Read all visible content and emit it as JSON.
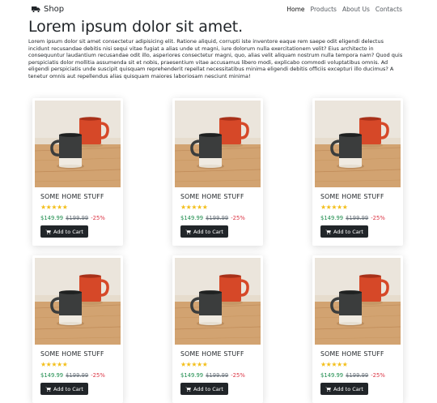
{
  "nav": {
    "brand": "Shop",
    "links": [
      "Home",
      "Products",
      "About Us",
      "Contacts"
    ],
    "active": "Home"
  },
  "hero": {
    "title": "Lorem ipsum dolor sit amet.",
    "text": "Lorem ipsum dolor sit amet consectetur adipisicing elit. Ratione aliquid, corrupti iste inventore eaque rem saepe odit eligendi delectus incidunt recusandae debitis nisi sequi vitae fugiat a alias unde ut magni, iure dolorum nulla exercitationem velit? Eius architecto in consequuntur laudantium recusandae odit illo, asperiores consectetur magni, quo, alias velit aliquam nostrum nulla tempora nam? Quod quis perspiciatis dolor mollitia assumenda sit et nobis, praesentium vitae accusamus libero modi, explicabo commodi voluptatibus omnis. Ad eligendi perspiciatis unde suscipit quisquam reprehenderit repellat necessitatibus minima eligendi debitis officiis excepturi illo ducimus? A tenetur omnis aut repellendus alias quisquam maiores laboriosam nesciunt minima!"
  },
  "products": [
    {
      "name": "SOME HOME STUFF",
      "rating": 4.5,
      "price": "$149.99",
      "old_price": "$199.99",
      "discount": "-25%",
      "button": "Add to Cart"
    },
    {
      "name": "SOME HOME STUFF",
      "rating": 4.5,
      "price": "$149.99",
      "old_price": "$199.99",
      "discount": "-25%",
      "button": "Add to Cart"
    },
    {
      "name": "SOME HOME STUFF",
      "rating": 4.5,
      "price": "$149.99",
      "old_price": "$199.99",
      "discount": "-25%",
      "button": "Add to Cart"
    },
    {
      "name": "SOME HOME STUFF",
      "rating": 4.5,
      "price": "$149.99",
      "old_price": "$199.99",
      "discount": "-25%",
      "button": "Add to Cart"
    },
    {
      "name": "SOME HOME STUFF",
      "rating": 4.5,
      "price": "$149.99",
      "old_price": "$199.99",
      "discount": "-25%",
      "button": "Add to Cart"
    },
    {
      "name": "SOME HOME STUFF",
      "rating": 4.5,
      "price": "$149.99",
      "old_price": "$199.99",
      "discount": "-25%",
      "button": "Add to Cart"
    }
  ],
  "icons": {
    "brand": "truck-icon",
    "button": "cart-icon",
    "rating": "star-icon"
  },
  "colors": {
    "price": "#1c8c4c",
    "discount": "#dc3545",
    "star": "#f3bf1b",
    "button": "#212529"
  }
}
